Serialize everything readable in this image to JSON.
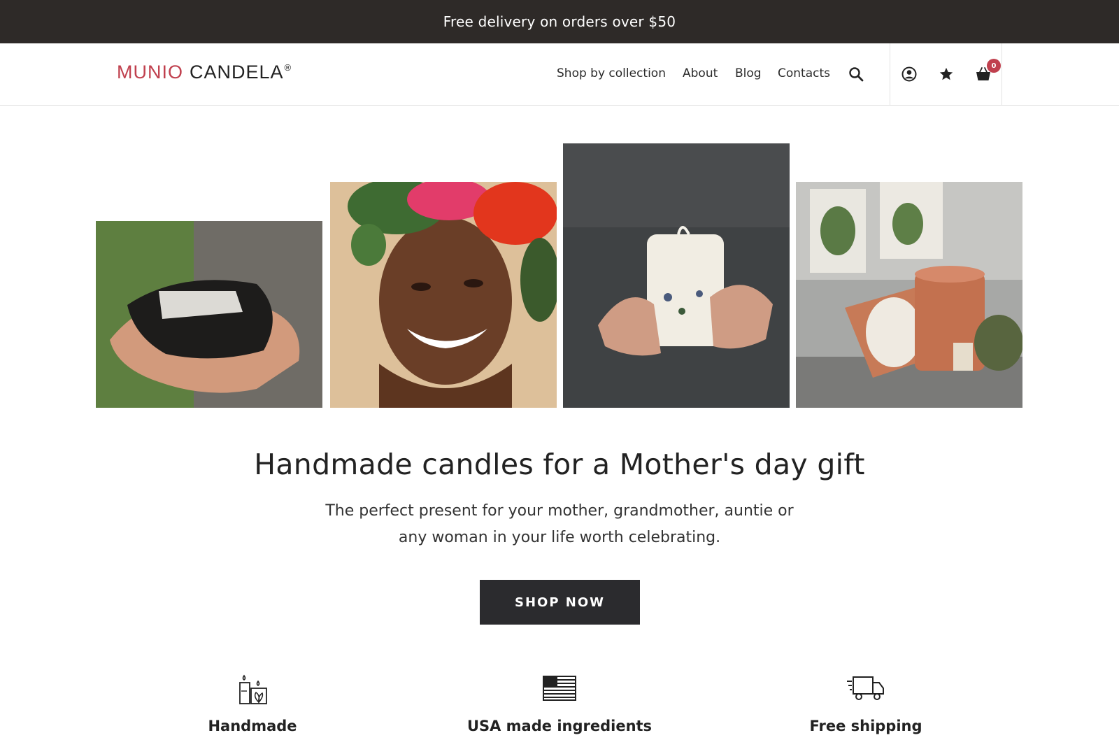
{
  "promo": {
    "text": "Free delivery on orders over $50"
  },
  "header": {
    "logo": {
      "part1": "MUNIO",
      "part2": "CANDELA",
      "mark": "®"
    },
    "nav": [
      {
        "label": "Shop by collection"
      },
      {
        "label": "About"
      },
      {
        "label": "Blog"
      },
      {
        "label": "Contacts"
      }
    ],
    "icons": [
      "search-icon",
      "account-icon",
      "star-icon",
      "cart-icon"
    ],
    "cart_count": "0"
  },
  "hero": {
    "title": "Handmade candles for a Mother's day gift",
    "subtitle_line1": "The perfect present for your mother, grandmother, auntie or",
    "subtitle_line2": "any woman in your life worth celebrating.",
    "cta": "SHOP NOW"
  },
  "features": [
    {
      "icon": "candles-icon",
      "title": "Handmade"
    },
    {
      "icon": "usa-flag-icon",
      "title": "USA made ingredients"
    },
    {
      "icon": "delivery-truck-icon",
      "title": "Free shipping"
    }
  ],
  "colors": {
    "promo_bg": "#2e2a28",
    "accent": "#c0404e",
    "button_bg": "#2b2b2e"
  }
}
